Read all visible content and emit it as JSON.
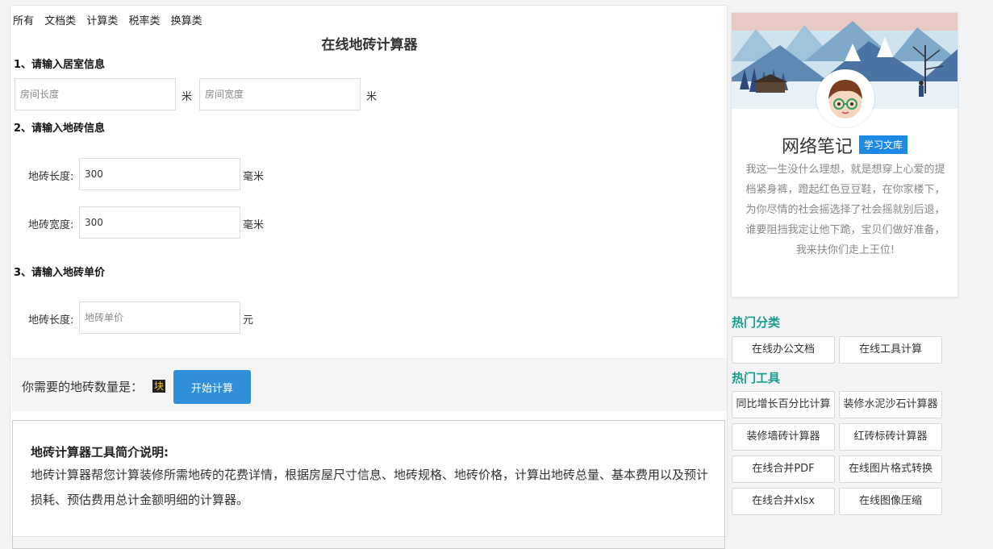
{
  "nav": {
    "items": [
      "所有",
      "文档类",
      "计算类",
      "税率类",
      "换算类"
    ]
  },
  "page_title": "在线地砖计算器",
  "section1": {
    "heading": "1、请输入居室信息",
    "length_placeholder": "房间长度",
    "width_placeholder": "房间宽度",
    "unit": "米"
  },
  "section2": {
    "heading": "2、请输入地砖信息",
    "length_label": "地砖长度:",
    "length_value": "300",
    "width_label": "地砖宽度:",
    "width_value": "300",
    "unit": "毫米"
  },
  "section3": {
    "heading": "3、请输入地砖单价",
    "price_label": "地砖长度:",
    "price_placeholder": "地砖单价",
    "unit": "元"
  },
  "result": {
    "text": "你需要的地砖数量是：",
    "badge": "块",
    "button": "开始计算"
  },
  "intro": {
    "heading": "地砖计算器工具简介说明:",
    "body": "地砖计算器帮您计算装修所需地砖的花费详情，根据房屋尺寸信息、地砖规格、地砖价格，计算出地砖总量、基本费用以及预计损耗、预估费用总计金额明细的计算器。"
  },
  "sidebar": {
    "site_name": "网络笔记",
    "site_tag": "学习文库",
    "motto": "我这一生没什么理想，就是想穿上心爱的提档紧身裤，蹬起红色豆豆鞋，在你家楼下，为你尽情的社会摇选择了社会摇就别后退，谁要阻挡我定让他下跪，宝贝们做好准备，我来扶你们走上王位!",
    "hot_categories_title": "热门分类",
    "hot_categories": [
      "在线办公文档",
      "在线工具计算"
    ],
    "hot_tools_title": "热门工具",
    "hot_tools": [
      "同比增长百分比计算",
      "装修水泥沙石计算器",
      "装修墙砖计算器",
      "红砖标砖计算器",
      "在线合并PDF",
      "在线图片格式转换",
      "在线合并xlsx",
      "在线图像压缩"
    ]
  },
  "colors": {
    "accent_blue": "#2f8fd8",
    "section_green": "#1a9e8f",
    "tag_blue": "#1e88e5"
  }
}
